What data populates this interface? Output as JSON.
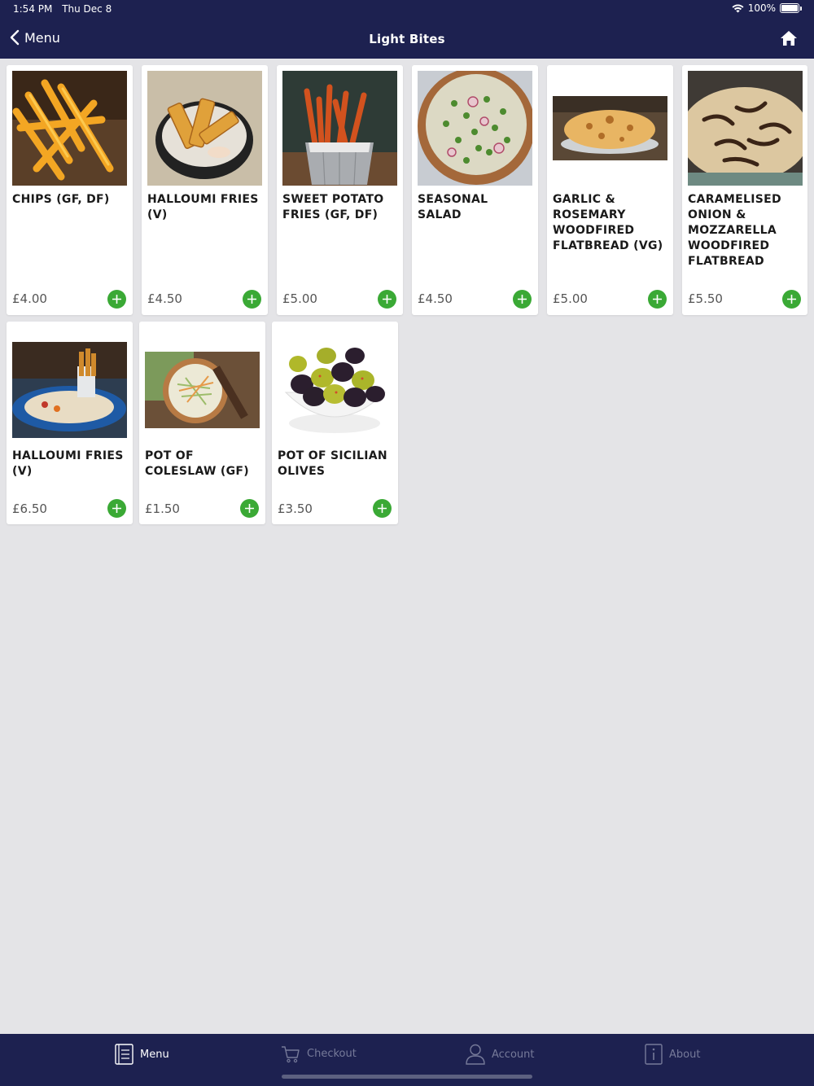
{
  "status": {
    "time": "1:54 PM",
    "date": "Thu Dec 8",
    "battery": "100%"
  },
  "nav": {
    "back_label": "Menu",
    "title": "Light Bites"
  },
  "items": [
    {
      "name": "CHIPS (GF, DF)",
      "price": "£4.00",
      "icon": "chips-photo"
    },
    {
      "name": "HALLOUMI FRIES (V)",
      "price": "£4.50",
      "icon": "halloumi-photo"
    },
    {
      "name": "SWEET POTATO FRIES (GF, DF)",
      "price": "£5.00",
      "icon": "sweet-potato-photo"
    },
    {
      "name": "SEASONAL SALAD",
      "price": "£4.50",
      "icon": "salad-photo"
    },
    {
      "name": "GARLIC & ROSEMARY WOODFIRED FLATBREAD (VG)",
      "price": "£5.00",
      "icon": "flatbread-photo"
    },
    {
      "name": "CARAMELISED ONION & MOZZARELLA WOODFIRED FLATBREAD",
      "price": "£5.50",
      "icon": "onion-flatbread-photo"
    },
    {
      "name": "HALLOUMI FRIES (V)",
      "price": "£6.50",
      "icon": "halloumi-platter-photo"
    },
    {
      "name": "POT OF COLESLAW (GF)",
      "price": "£1.50",
      "icon": "coleslaw-photo"
    },
    {
      "name": "POT OF SICILIAN OLIVES",
      "price": "£3.50",
      "icon": "olives-photo"
    }
  ],
  "tabs": [
    {
      "label": "Menu",
      "icon": "menu-book-icon",
      "active": true
    },
    {
      "label": "Checkout",
      "icon": "cart-icon",
      "active": false
    },
    {
      "label": "Account",
      "icon": "person-icon",
      "active": false
    },
    {
      "label": "About",
      "icon": "info-icon",
      "active": false
    }
  ],
  "colors": {
    "header": "#1d2150",
    "accent": "#3aa935",
    "background": "#e4e4e7"
  }
}
